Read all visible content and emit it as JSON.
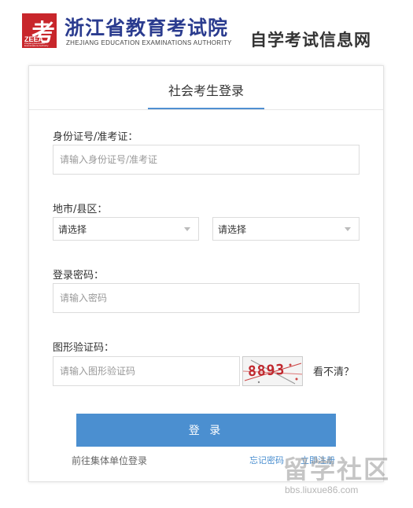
{
  "header": {
    "logo_kao": "考",
    "logo_zee": "ZEEA",
    "logo_sub": "Zhejiang Education Examinations Authority",
    "org_name": "浙江省教育考试院",
    "org_name_en": "ZHEJIANG EDUCATION EXAMINATIONS AUTHORITY",
    "site_name": "自学考试信息网"
  },
  "login": {
    "title": "社会考生登录",
    "id_label": "身份证号/准考证：",
    "id_placeholder": "请输入身份证号/准考证",
    "region_label": "地市/县区：",
    "city_select": "请选择",
    "county_select": "请选择",
    "password_label": "登录密码：",
    "password_placeholder": "请输入密码",
    "captcha_label": "图形验证码：",
    "captcha_placeholder": "请输入图形验证码",
    "captcha_code": "8893",
    "refresh_label": "看不清？",
    "submit_label": "登 录",
    "unit_link": "前往集体单位登录",
    "forgot_link": "忘记密码",
    "register_link": "立即注册"
  },
  "watermark": {
    "text": "留学社区",
    "url": "bbs.liuxue86.com"
  }
}
